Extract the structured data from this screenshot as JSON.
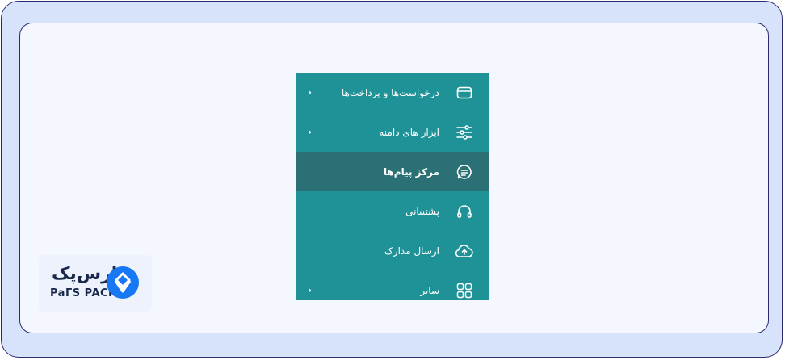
{
  "menu": {
    "items": [
      {
        "label": "درخواست‌ها و پرداخت‌ها",
        "icon": "credit-card-icon",
        "has_submenu": true,
        "active": false
      },
      {
        "label": "ابزار های دامنه",
        "icon": "sliders-icon",
        "has_submenu": true,
        "active": false
      },
      {
        "label": "مرکز پیام‌ها",
        "icon": "message-icon",
        "has_submenu": false,
        "active": true
      },
      {
        "label": "پشتیبانی",
        "icon": "headset-icon",
        "has_submenu": false,
        "active": false
      },
      {
        "label": "ارسال مدارک",
        "icon": "cloud-upload-icon",
        "has_submenu": false,
        "active": false
      },
      {
        "label": "سایر",
        "icon": "grid-icon",
        "has_submenu": true,
        "active": false
      }
    ],
    "chevron": "›"
  },
  "logo": {
    "persian_text": "پارس‌پک",
    "english_text": "PaΓS PACK"
  },
  "colors": {
    "menu_bg": "#1f9297",
    "menu_active_bg": "#2a7074",
    "outer_bg": "#d6e3fb",
    "inner_bg": "#f4f7fe",
    "frame_border": "#2d2a6e",
    "logo_blue": "#1877f2"
  }
}
